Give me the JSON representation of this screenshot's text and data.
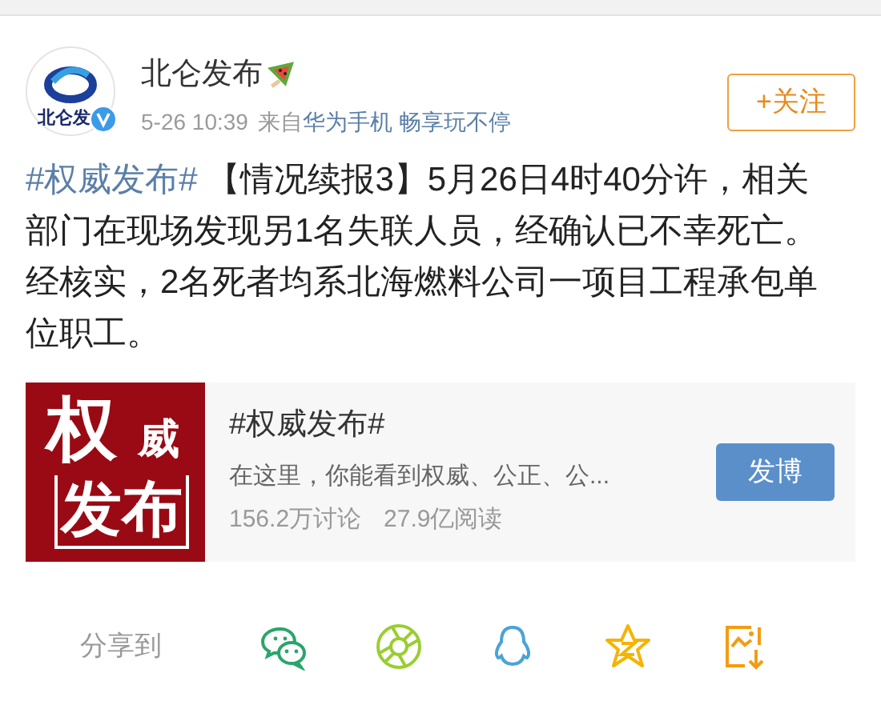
{
  "post": {
    "author": "北仑发布",
    "avatar_caption": "北仑发",
    "verified": true,
    "time": "5-26 10:39",
    "source_prefix": "来自",
    "source": "华为手机 畅享玩不停",
    "follow_button": "+关注",
    "hashtag": "#权威发布#",
    "text": "【情况续报3】5月26日4时40分许，相关部门在现场发现另1名失联人员，经确认已不幸死亡。经核实，2名死者均系北海燃料公司一项目工程承包单位职工。"
  },
  "topic_card": {
    "cover_line_1": "权",
    "cover_line_2": "威",
    "cover_line_3": "发布",
    "title": "#权威发布#",
    "description": "在这里，你能看到权威、公正、公...",
    "discussions": "156.2万讨论",
    "reads": "27.9亿阅读",
    "button": "发博"
  },
  "share_bar": {
    "label": "分享到",
    "targets": [
      {
        "kind": "wechat"
      },
      {
        "kind": "moments"
      },
      {
        "kind": "qq"
      },
      {
        "kind": "qzone"
      },
      {
        "kind": "save"
      }
    ]
  }
}
